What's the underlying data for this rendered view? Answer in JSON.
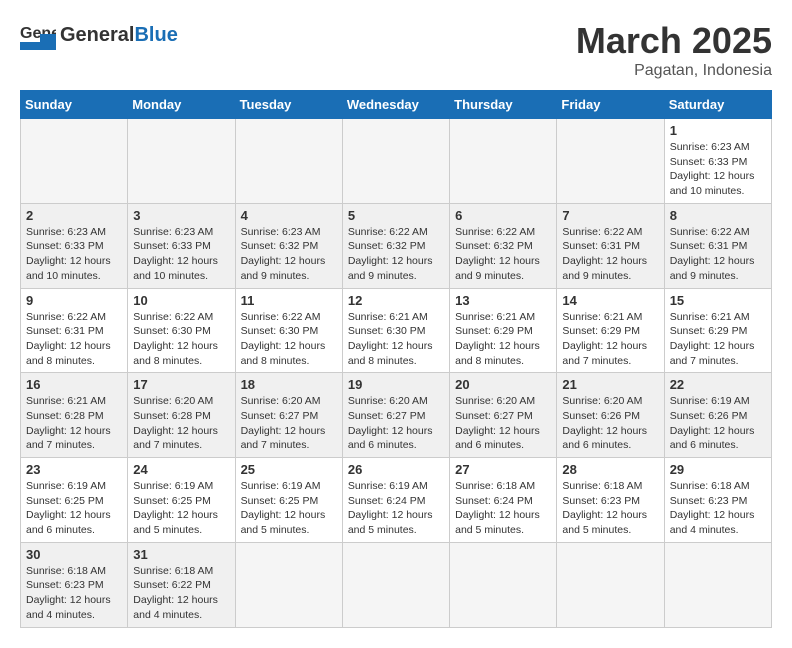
{
  "header": {
    "logo_general": "General",
    "logo_blue": "Blue",
    "month_title": "March 2025",
    "subtitle": "Pagatan, Indonesia"
  },
  "weekdays": [
    "Sunday",
    "Monday",
    "Tuesday",
    "Wednesday",
    "Thursday",
    "Friday",
    "Saturday"
  ],
  "weeks": [
    [
      {
        "day": "",
        "info": ""
      },
      {
        "day": "",
        "info": ""
      },
      {
        "day": "",
        "info": ""
      },
      {
        "day": "",
        "info": ""
      },
      {
        "day": "",
        "info": ""
      },
      {
        "day": "",
        "info": ""
      },
      {
        "day": "1",
        "info": "Sunrise: 6:23 AM\nSunset: 6:33 PM\nDaylight: 12 hours and 10 minutes."
      }
    ],
    [
      {
        "day": "2",
        "info": "Sunrise: 6:23 AM\nSunset: 6:33 PM\nDaylight: 12 hours and 10 minutes."
      },
      {
        "day": "3",
        "info": "Sunrise: 6:23 AM\nSunset: 6:33 PM\nDaylight: 12 hours and 10 minutes."
      },
      {
        "day": "4",
        "info": "Sunrise: 6:23 AM\nSunset: 6:32 PM\nDaylight: 12 hours and 9 minutes."
      },
      {
        "day": "5",
        "info": "Sunrise: 6:22 AM\nSunset: 6:32 PM\nDaylight: 12 hours and 9 minutes."
      },
      {
        "day": "6",
        "info": "Sunrise: 6:22 AM\nSunset: 6:32 PM\nDaylight: 12 hours and 9 minutes."
      },
      {
        "day": "7",
        "info": "Sunrise: 6:22 AM\nSunset: 6:31 PM\nDaylight: 12 hours and 9 minutes."
      },
      {
        "day": "8",
        "info": "Sunrise: 6:22 AM\nSunset: 6:31 PM\nDaylight: 12 hours and 9 minutes."
      }
    ],
    [
      {
        "day": "9",
        "info": "Sunrise: 6:22 AM\nSunset: 6:31 PM\nDaylight: 12 hours and 8 minutes."
      },
      {
        "day": "10",
        "info": "Sunrise: 6:22 AM\nSunset: 6:30 PM\nDaylight: 12 hours and 8 minutes."
      },
      {
        "day": "11",
        "info": "Sunrise: 6:22 AM\nSunset: 6:30 PM\nDaylight: 12 hours and 8 minutes."
      },
      {
        "day": "12",
        "info": "Sunrise: 6:21 AM\nSunset: 6:30 PM\nDaylight: 12 hours and 8 minutes."
      },
      {
        "day": "13",
        "info": "Sunrise: 6:21 AM\nSunset: 6:29 PM\nDaylight: 12 hours and 8 minutes."
      },
      {
        "day": "14",
        "info": "Sunrise: 6:21 AM\nSunset: 6:29 PM\nDaylight: 12 hours and 7 minutes."
      },
      {
        "day": "15",
        "info": "Sunrise: 6:21 AM\nSunset: 6:29 PM\nDaylight: 12 hours and 7 minutes."
      }
    ],
    [
      {
        "day": "16",
        "info": "Sunrise: 6:21 AM\nSunset: 6:28 PM\nDaylight: 12 hours and 7 minutes."
      },
      {
        "day": "17",
        "info": "Sunrise: 6:20 AM\nSunset: 6:28 PM\nDaylight: 12 hours and 7 minutes."
      },
      {
        "day": "18",
        "info": "Sunrise: 6:20 AM\nSunset: 6:27 PM\nDaylight: 12 hours and 7 minutes."
      },
      {
        "day": "19",
        "info": "Sunrise: 6:20 AM\nSunset: 6:27 PM\nDaylight: 12 hours and 6 minutes."
      },
      {
        "day": "20",
        "info": "Sunrise: 6:20 AM\nSunset: 6:27 PM\nDaylight: 12 hours and 6 minutes."
      },
      {
        "day": "21",
        "info": "Sunrise: 6:20 AM\nSunset: 6:26 PM\nDaylight: 12 hours and 6 minutes."
      },
      {
        "day": "22",
        "info": "Sunrise: 6:19 AM\nSunset: 6:26 PM\nDaylight: 12 hours and 6 minutes."
      }
    ],
    [
      {
        "day": "23",
        "info": "Sunrise: 6:19 AM\nSunset: 6:25 PM\nDaylight: 12 hours and 6 minutes."
      },
      {
        "day": "24",
        "info": "Sunrise: 6:19 AM\nSunset: 6:25 PM\nDaylight: 12 hours and 5 minutes."
      },
      {
        "day": "25",
        "info": "Sunrise: 6:19 AM\nSunset: 6:25 PM\nDaylight: 12 hours and 5 minutes."
      },
      {
        "day": "26",
        "info": "Sunrise: 6:19 AM\nSunset: 6:24 PM\nDaylight: 12 hours and 5 minutes."
      },
      {
        "day": "27",
        "info": "Sunrise: 6:18 AM\nSunset: 6:24 PM\nDaylight: 12 hours and 5 minutes."
      },
      {
        "day": "28",
        "info": "Sunrise: 6:18 AM\nSunset: 6:23 PM\nDaylight: 12 hours and 5 minutes."
      },
      {
        "day": "29",
        "info": "Sunrise: 6:18 AM\nSunset: 6:23 PM\nDaylight: 12 hours and 4 minutes."
      }
    ],
    [
      {
        "day": "30",
        "info": "Sunrise: 6:18 AM\nSunset: 6:23 PM\nDaylight: 12 hours and 4 minutes."
      },
      {
        "day": "31",
        "info": "Sunrise: 6:18 AM\nSunset: 6:22 PM\nDaylight: 12 hours and 4 minutes."
      },
      {
        "day": "",
        "info": ""
      },
      {
        "day": "",
        "info": ""
      },
      {
        "day": "",
        "info": ""
      },
      {
        "day": "",
        "info": ""
      },
      {
        "day": "",
        "info": ""
      }
    ]
  ]
}
